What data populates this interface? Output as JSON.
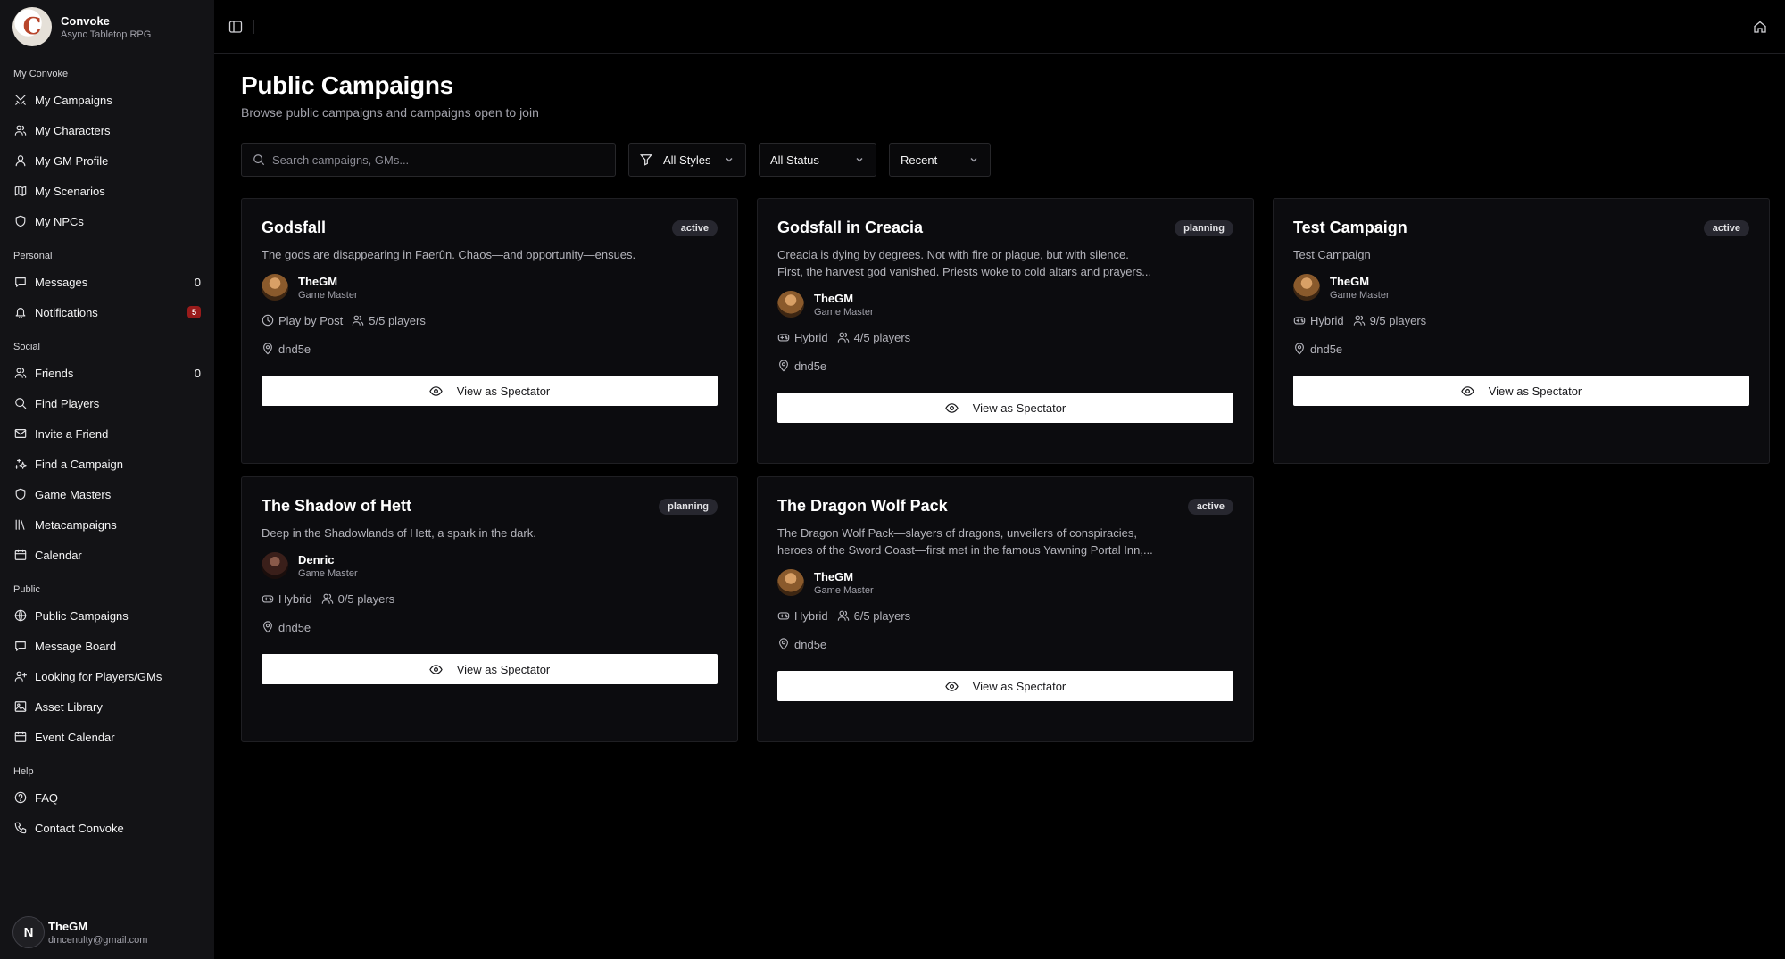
{
  "brand": {
    "name": "Convoke",
    "subtitle": "Async Tabletop RPG",
    "logo_letter": "C"
  },
  "sidebar": {
    "groups": [
      {
        "title": "My Convoke",
        "items": [
          {
            "label": "My Campaigns",
            "icon": "swords-icon"
          },
          {
            "label": "My Characters",
            "icon": "users-icon"
          },
          {
            "label": "My GM Profile",
            "icon": "user-icon"
          },
          {
            "label": "My Scenarios",
            "icon": "map-icon"
          },
          {
            "label": "My NPCs",
            "icon": "shield-icon"
          }
        ]
      },
      {
        "title": "Personal",
        "items": [
          {
            "label": "Messages",
            "icon": "message-icon",
            "count": "0"
          },
          {
            "label": "Notifications",
            "icon": "bell-icon",
            "badge": "5"
          }
        ]
      },
      {
        "title": "Social",
        "items": [
          {
            "label": "Friends",
            "icon": "users-icon",
            "count": "0"
          },
          {
            "label": "Find Players",
            "icon": "search-icon"
          },
          {
            "label": "Invite a Friend",
            "icon": "mail-icon"
          },
          {
            "label": "Find a Campaign",
            "icon": "sparkles-icon"
          },
          {
            "label": "Game Masters",
            "icon": "shield-icon"
          },
          {
            "label": "Metacampaigns",
            "icon": "library-icon"
          },
          {
            "label": "Calendar",
            "icon": "calendar-icon"
          }
        ]
      },
      {
        "title": "Public",
        "items": [
          {
            "label": "Public Campaigns",
            "icon": "globe-icon"
          },
          {
            "label": "Message Board",
            "icon": "message-icon"
          },
          {
            "label": "Looking for Players/GMs",
            "icon": "user-plus-icon"
          },
          {
            "label": "Asset Library",
            "icon": "image-icon"
          },
          {
            "label": "Event Calendar",
            "icon": "calendar-icon"
          }
        ]
      },
      {
        "title": "Help",
        "items": [
          {
            "label": "FAQ",
            "icon": "help-circle-icon"
          },
          {
            "label": "Contact Convoke",
            "icon": "phone-icon"
          }
        ]
      }
    ]
  },
  "user": {
    "name": "TheGM",
    "email": "dmcenulty@gmail.com",
    "avatar_letter": "N"
  },
  "page": {
    "title": "Public Campaigns",
    "subtitle": "Browse public campaigns and campaigns open to join"
  },
  "filters": {
    "search_placeholder": "Search campaigns, GMs...",
    "styles": "All Styles",
    "status": "All Status",
    "sort": "Recent"
  },
  "spectate_label": "View as Spectator",
  "campaigns": [
    {
      "title": "Godsfall",
      "status": "active",
      "desc": [
        "The gods are disappearing in Faerûn. Chaos—and opportunity—ensues."
      ],
      "gm": "TheGM",
      "role": "Game Master",
      "style": "Play by Post",
      "style_icon": "clock-icon",
      "players": "5/5 players",
      "system": "dnd5e"
    },
    {
      "title": "Godsfall in Creacia",
      "status": "planning",
      "desc": [
        "Creacia is dying by degrees. Not with fire or plague, but with silence.",
        "First, the harvest god vanished. Priests woke to cold altars and prayers..."
      ],
      "gm": "TheGM",
      "role": "Game Master",
      "style": "Hybrid",
      "style_icon": "gamepad-icon",
      "players": "4/5 players",
      "system": "dnd5e"
    },
    {
      "title": "Test Campaign",
      "status": "active",
      "desc": [
        "Test Campaign"
      ],
      "gm": "TheGM",
      "role": "Game Master",
      "style": "Hybrid",
      "style_icon": "gamepad-icon",
      "players": "9/5 players",
      "system": "dnd5e"
    },
    {
      "title": "The Shadow of Hett",
      "status": "planning",
      "desc": [
        "Deep in the Shadowlands of Hett, a spark in the dark."
      ],
      "gm": "Denric",
      "role": "Game Master",
      "style": "Hybrid",
      "style_icon": "gamepad-icon",
      "players": "0/5 players",
      "system": "dnd5e"
    },
    {
      "title": "The Dragon Wolf Pack",
      "status": "active",
      "desc": [
        "The Dragon Wolf Pack—slayers of dragons, unveilers of conspiracies,",
        "heroes of the Sword Coast—first met in the famous Yawning Portal Inn,..."
      ],
      "gm": "TheGM",
      "role": "Game Master",
      "style": "Hybrid",
      "style_icon": "gamepad-icon",
      "players": "6/5 players",
      "system": "dnd5e"
    }
  ]
}
